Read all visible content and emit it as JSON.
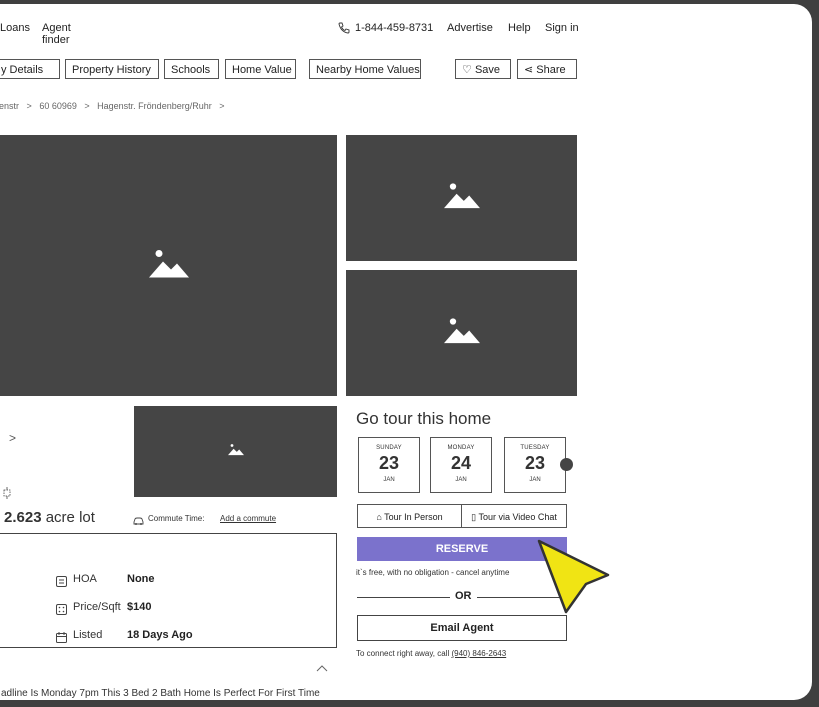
{
  "nav": {
    "loans": "Loans",
    "agent": "Agent",
    "finder": "finder",
    "phone": "1-844-459-8731",
    "advertise": "Advertise",
    "help": "Help",
    "signin": "Sign in"
  },
  "tabs": [
    "y Details",
    "Property History",
    "Schools",
    "Home Value",
    "Nearby Home Values"
  ],
  "actions": {
    "save": "Save",
    "share": "Share"
  },
  "breadcrumb": [
    "enstr",
    "60 60969",
    "Hagenstr. Fröndenberg/Ruhr"
  ],
  "listing": {
    "chevron": ">",
    "lot_value": "2.623",
    "lot_unit": "acre lot",
    "commute_label": "Commute Time:",
    "commute_link": "Add a commute"
  },
  "details": [
    {
      "label": "HOA",
      "value": "None",
      "icon": "hoa-icon"
    },
    {
      "label": "Price/Sqft",
      "value": "$140",
      "icon": "price-sqft-icon"
    },
    {
      "label": "Listed",
      "value": "18 Days Ago",
      "icon": "calendar-icon"
    }
  ],
  "description": "adline Is Monday 7pm This 3 Bed 2 Bath Home Is Perfect For First Time",
  "tour": {
    "title": "Go tour this home",
    "days": [
      {
        "name": "SUNDAY",
        "date": "23",
        "month": "JAN"
      },
      {
        "name": "MONDAY",
        "date": "24",
        "month": "JAN"
      },
      {
        "name": "TUESDAY",
        "date": "23",
        "month": "JAN"
      }
    ],
    "in_person": "Tour In Person",
    "video": "Tour via Video Chat",
    "reserve": "RESERVE",
    "reserve_color": "#7b72cc",
    "free_note": "it`s free, with no obligation - cancel anytime",
    "or": "OR",
    "email": "Email Agent",
    "call_prefix": "To connect right away, call",
    "call_number": "(940) 846-2643"
  }
}
